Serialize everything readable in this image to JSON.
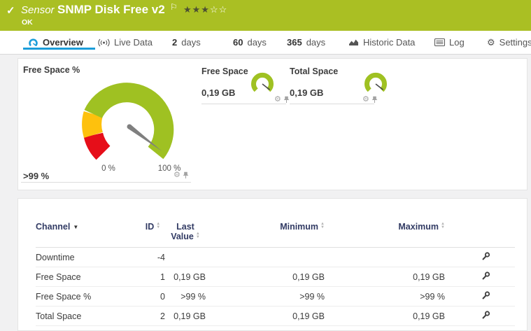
{
  "header": {
    "check": "✓",
    "kind": "Sensor",
    "title": "SNMP Disk Free v2",
    "flag": "⚐",
    "stars_filled": "★★★",
    "stars_empty": "☆☆",
    "status": "OK"
  },
  "tabs": {
    "overview": "Overview",
    "live": "Live Data",
    "d2_num": "2",
    "d2_unit": "days",
    "d60_num": "60",
    "d60_unit": "days",
    "d365_num": "365",
    "d365_unit": "days",
    "historic": "Historic Data",
    "log": "Log",
    "settings": "Settings"
  },
  "icons": {
    "gear": "⚙"
  },
  "panel": {
    "primary": {
      "title": "Free Space %",
      "value": ">99 %",
      "scale_min": "0 %",
      "scale_max": "100 %",
      "needle_percent": 99
    },
    "free": {
      "title": "Free Space",
      "value": "0,19 GB"
    },
    "total": {
      "title": "Total Space",
      "value": "0,19 GB"
    }
  },
  "chart_data": {
    "type": "gauge",
    "gauges": [
      {
        "title": "Free Space %",
        "value": ">99 %",
        "range": [
          "0 %",
          "100 %"
        ],
        "zones": [
          "red",
          "yellow",
          "green"
        ]
      },
      {
        "title": "Free Space",
        "value": "0,19 GB"
      },
      {
        "title": "Total Space",
        "value": "0,19 GB"
      }
    ]
  },
  "table": {
    "headers": {
      "channel": "Channel",
      "id": "ID",
      "last_line1": "Last",
      "last_line2": "Value",
      "min": "Minimum",
      "max": "Maximum"
    },
    "rows": [
      {
        "channel": "Downtime",
        "id": "-4",
        "last": "",
        "min": "",
        "max": ""
      },
      {
        "channel": "Free Space",
        "id": "1",
        "last": "0,19 GB",
        "min": "0,19 GB",
        "max": "0,19 GB"
      },
      {
        "channel": "Free Space %",
        "id": "0",
        "last": ">99 %",
        "min": ">99 %",
        "max": ">99 %"
      },
      {
        "channel": "Total Space",
        "id": "2",
        "last": "0,19 GB",
        "min": "0,19 GB",
        "max": "0,19 GB"
      }
    ]
  },
  "colors": {
    "header_green": "#aabf23",
    "gauge_green": "#9fc122",
    "gauge_yellow": "#fec10d",
    "gauge_red": "#e60e19",
    "accent_blue": "#1b9dd9",
    "table_header_navy": "#323b64"
  }
}
